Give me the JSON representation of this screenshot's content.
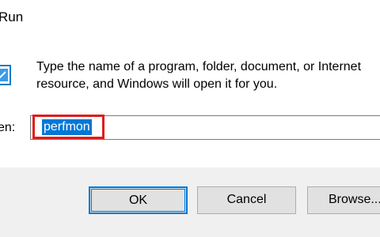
{
  "window": {
    "title": "Run"
  },
  "icons": {
    "app": "run-app-icon"
  },
  "message": {
    "line1": "Type the name of a program, folder, document, or Internet",
    "line2": "resource, and Windows will open it for you."
  },
  "open_field": {
    "label": "en:",
    "value": "perfmon"
  },
  "buttons": {
    "ok": "OK",
    "cancel": "Cancel",
    "browse": "Browse..."
  },
  "colors": {
    "accent": "#0078d7",
    "highlight": "#e21a1a",
    "footer": "#f0f0f0"
  }
}
